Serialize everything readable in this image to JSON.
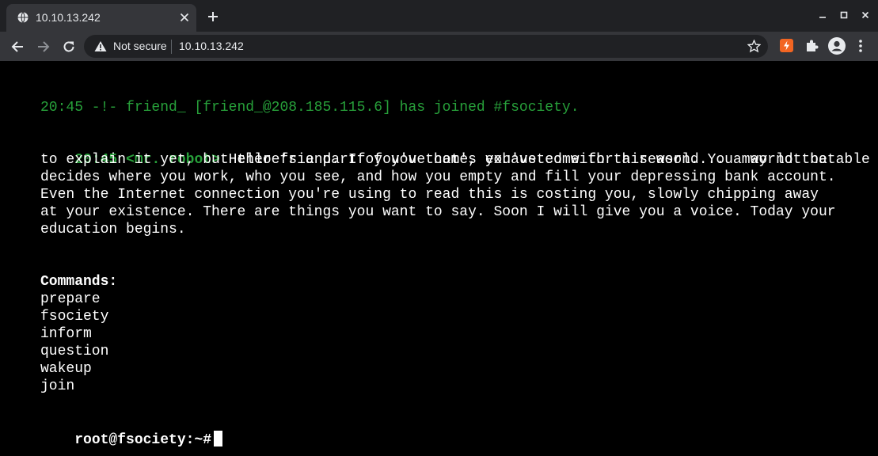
{
  "browser": {
    "tab": {
      "title": "10.10.13.242",
      "favicon": "globe-icon",
      "close_icon": "close-icon"
    },
    "new_tab_icon": "plus-icon",
    "window_controls": [
      "minimize-icon",
      "maximize-icon",
      "close-icon"
    ],
    "toolbar": {
      "back_icon": "arrow-left-icon",
      "forward_icon": "arrow-right-icon",
      "reload_icon": "reload-icon",
      "security_icon": "warning-icon",
      "security_text": "Not secure",
      "url": "10.10.13.242",
      "bookmark_icon": "star-icon",
      "extensions": [
        "red-extension-icon",
        "puzzle-icon"
      ],
      "profile_icon": "account-icon",
      "menu_icon": "three-dots-icon"
    }
  },
  "terminal": {
    "join_line": "20:45 -!- friend_ [friend_@208.185.115.6] has joined #fsociety.",
    "message": {
      "time": "20:45",
      "nick": "<mr. robot>",
      "lines": [
        " Hello friend. If you've come, you've come for a reason. You may not be able",
        "to explain it yet, but there's a part of you that's exhausted with this world... a world that",
        "decides where you work, who you see, and how you empty and fill your depressing bank account.",
        "Even the Internet connection you're using to read this is costing you, slowly chipping away",
        "at your existence. There are things you want to say. Soon I will give you a voice. Today your",
        "education begins."
      ]
    },
    "commands_heading": "Commands:",
    "commands": [
      "prepare",
      "fsociety",
      "inform",
      "question",
      "wakeup",
      "join"
    ],
    "prompt": "root@fsociety:~#",
    "colors": {
      "background": "#000000",
      "irc_green": "#27a03a",
      "text": "#ffffff"
    }
  }
}
